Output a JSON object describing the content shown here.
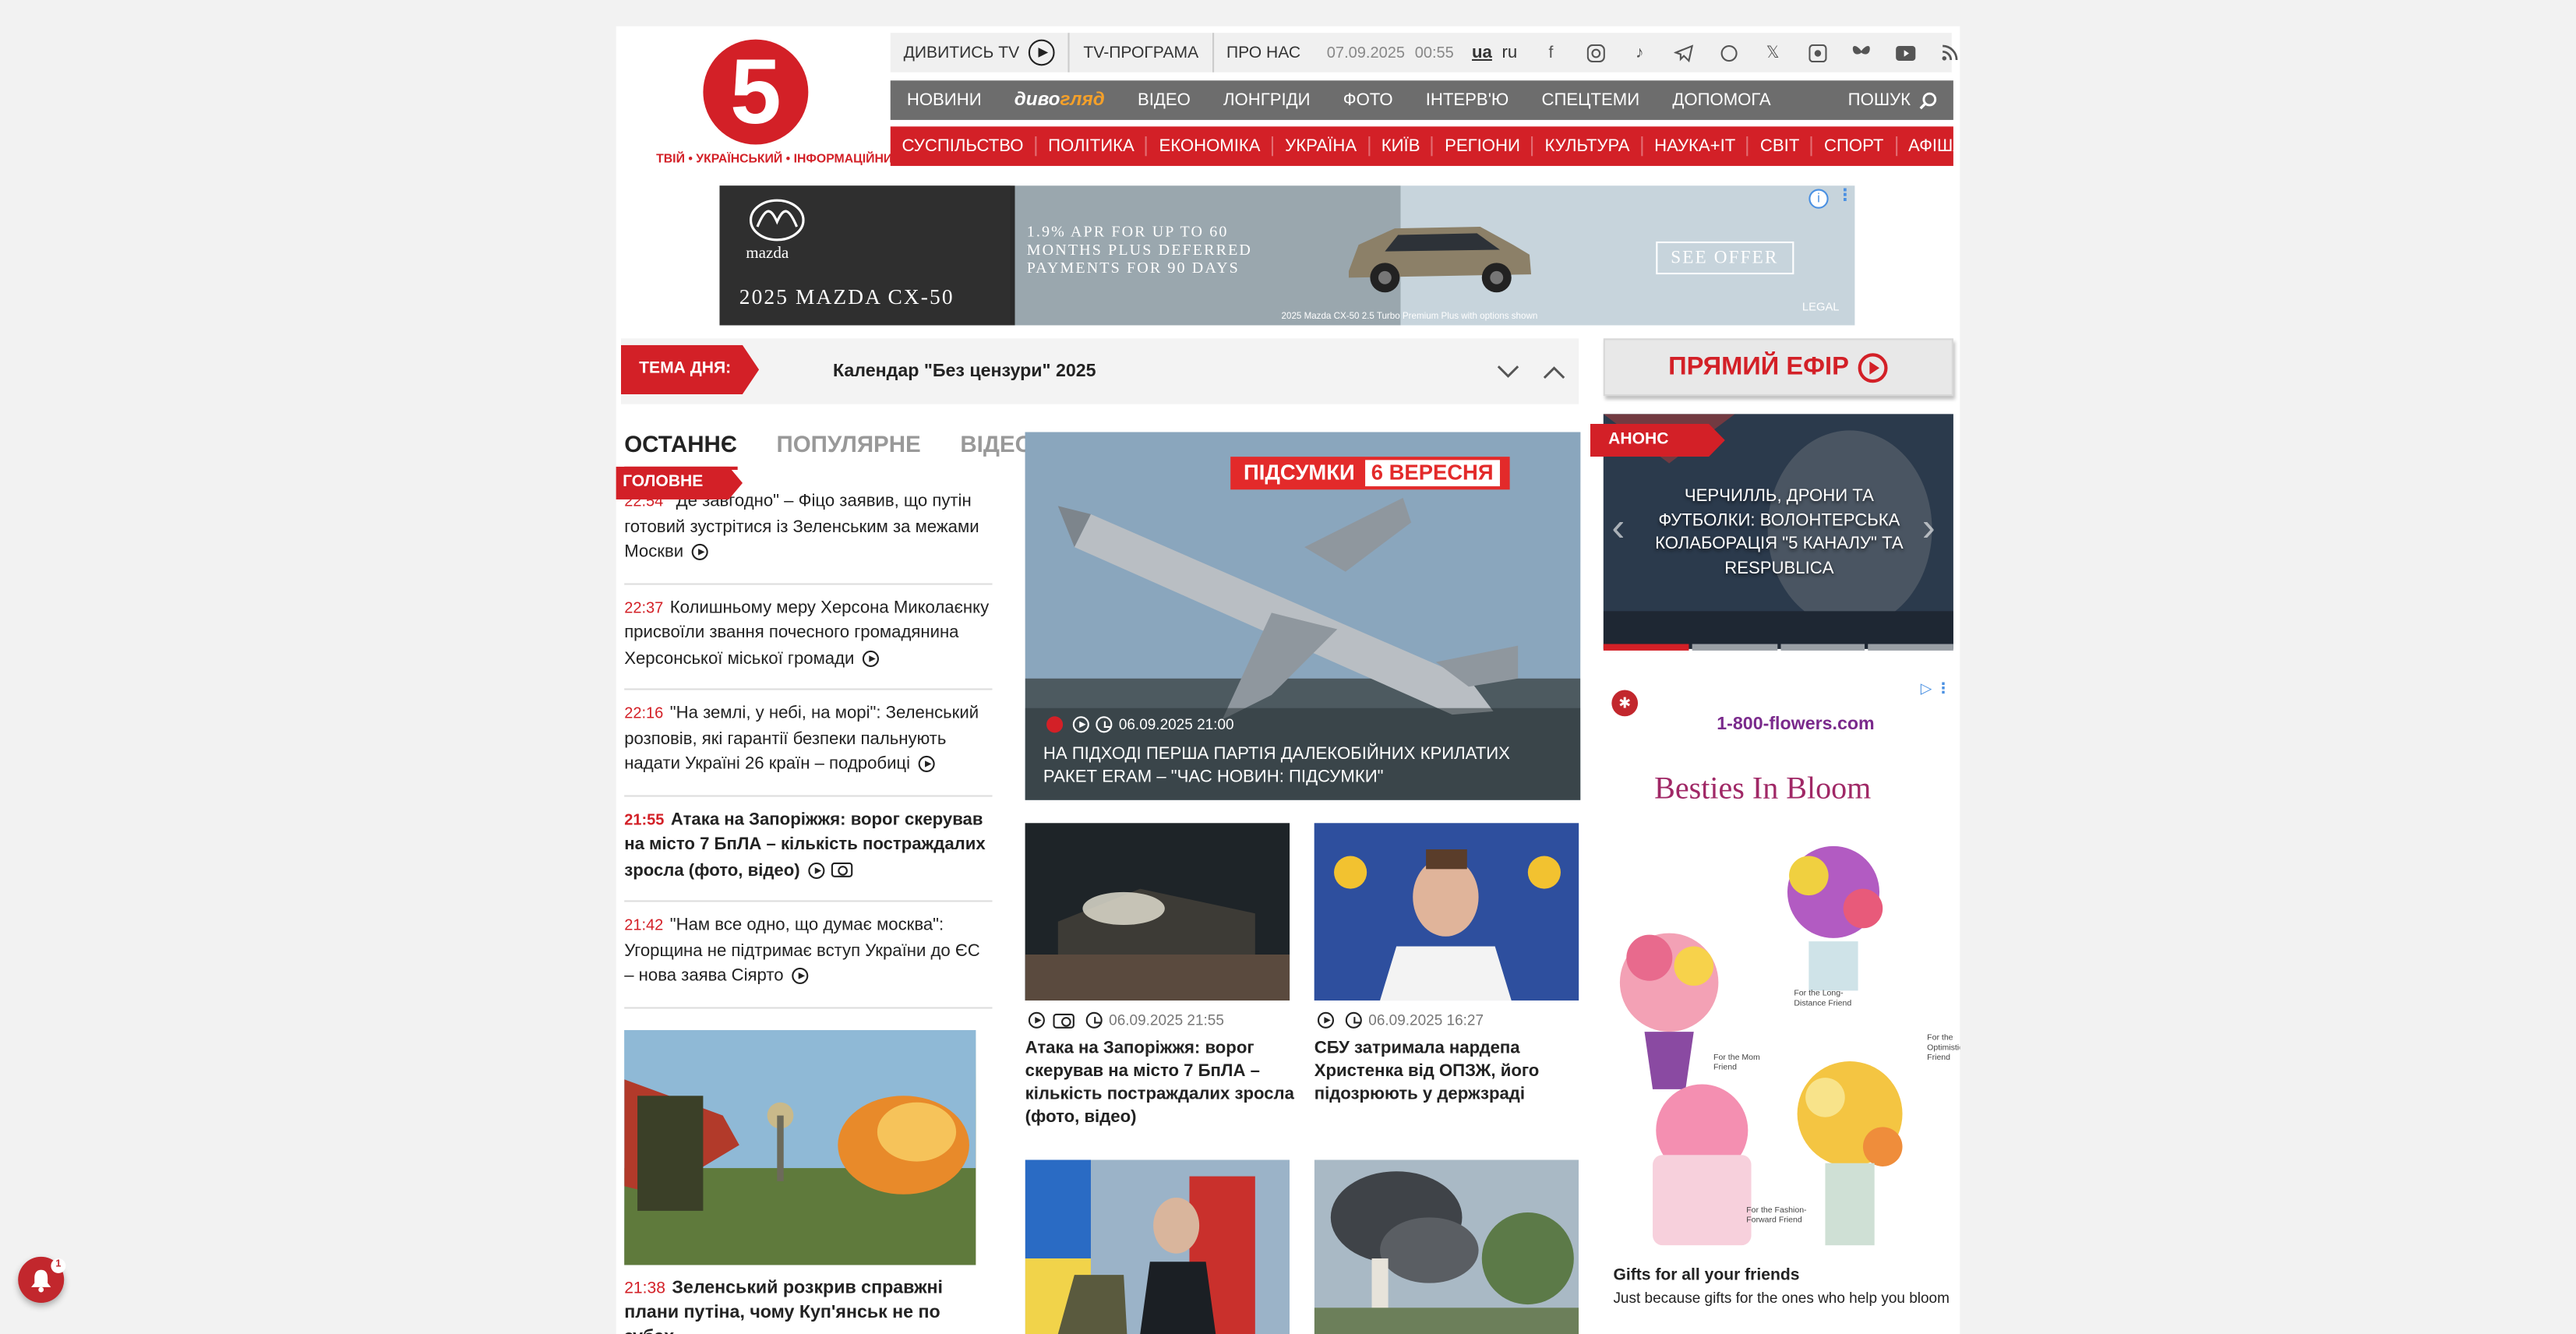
{
  "logo": {
    "number": "5",
    "tagline": "ТВІЙ • УКРАЇНСЬКИЙ • ІНФОРМАЦІЙНИЙ"
  },
  "topbar": {
    "watch_tv": "ДИВИТИСЬ TV",
    "tv_program": "TV-ПРОГРАМА",
    "about": "ПРО НАС",
    "date": "07.09.2025",
    "time": "00:55",
    "lang_ua": "ua",
    "lang_ru": "ru",
    "social": [
      "facebook-icon",
      "instagram-icon",
      "tiktok-icon",
      "telegram-icon",
      "whatsapp-icon",
      "x-icon",
      "threads-icon",
      "bluesky-icon",
      "youtube-icon",
      "rss-icon"
    ]
  },
  "nav_main": {
    "items": [
      "НОВИНИ",
      "ДИВОГЛЯД",
      "ВІДЕО",
      "ЛОНГРІДИ",
      "ФОТО",
      "ІНТЕРВ'Ю",
      "СПЕЦТЕМИ",
      "ДОПОМОГА"
    ],
    "divo_a": "диво",
    "divo_b": "гляд",
    "search": "ПОШУК"
  },
  "nav_sections": [
    "СУСПІЛЬСТВО",
    "ПОЛІТИКА",
    "ЕКОНОМІКА",
    "УКРАЇНА",
    "КИЇВ",
    "РЕГІОНИ",
    "КУЛЬТУРА",
    "НАУКА+IT",
    "СВІТ",
    "СПОРТ",
    "АФІША"
  ],
  "ad_top": {
    "brand": "mazda",
    "model": "2025 MAZDA CX-50",
    "copy": "1.9% APR FOR UP TO 60 MONTHS PLUS DEFERRED PAYMENTS FOR 90 DAYS",
    "cta": "SEE OFFER",
    "legal": "LEGAL",
    "fine": "2025 Mazda CX-50 2.5 Turbo Premium Plus with options shown"
  },
  "theme_day": {
    "tag": "ТЕМА ДНЯ:",
    "title": "Календар \"Без цензури\" 2025"
  },
  "live": {
    "label": "ПРЯМИЙ ЕФІР"
  },
  "tabs": [
    "ОСТАННЄ",
    "ПОПУЛЯРНЕ",
    "ВІДЕО"
  ],
  "news_list": [
    {
      "time": "22:54",
      "text": "\"Де завгодно\" – Фіцо заявив, що путін готовий зустрітися із Зеленським за межами Москви",
      "bold": false
    },
    {
      "time": "22:37",
      "text": "Колишньому меру Херсона Миколаєнку присвоїли звання почесного громадянина Херсонської міської громади",
      "bold": false
    },
    {
      "time": "22:16",
      "text": "\"На землі, у небі, на морі\": Зеленський розповів, які гарантії безпеки пальнують надати Україні 26 країн – подробиці",
      "bold": false
    },
    {
      "time": "21:55",
      "text": "Атака на Запоріжжя: ворог скерував на місто 7 БпЛА – кількість постраждалих зросла (фото, відео)",
      "bold": true
    },
    {
      "time": "21:42",
      "text": "\"Нам все одно, що думає москва\": Угорщина не підтримає вступ України до ЄС – нова заява Сіярто",
      "bold": false
    }
  ],
  "left_feature": {
    "time": "21:38",
    "title": "Зеленський розкрив справжні плани путіна, чому Куп'янськ не по зубах"
  },
  "hero": {
    "tag": "ГОЛОВНЕ",
    "badge": "ПІДСУМКИ",
    "badge_date": "6 ВЕРЕСНЯ",
    "datetime": "06.09.2025 21:00",
    "title": "НА ПІДХОДІ ПЕРША ПАРТІЯ ДАЛЕКОБІЙНИХ КРИЛАТИХ РАКЕТ ERAM – \"ЧАС НОВИН: ПІДСУМКИ\""
  },
  "cards": [
    {
      "datetime": "06.09.2025 21:55",
      "title": "Атака на Запоріжжя: ворог скерував на місто 7 БпЛА – кількість постраждалих зросла (фото, відео)"
    },
    {
      "datetime": "06.09.2025 16:27",
      "title": "СБУ затримала нардепа Христенка від ОПЗЖ, його підозрюють у держзраді"
    }
  ],
  "anons": {
    "tag": "АНОНС",
    "title": "ЧЕРЧИЛЛЬ, ДРОНИ ТА ФУТБОЛКИ: ВОЛОНТЕРСЬКА КОЛАБОРАЦІЯ \"5 КАНАЛУ\" ТА RESPUBLICA"
  },
  "ad_right": {
    "logo": "1-800-flowers.com",
    "headline": "Besties In Bloom",
    "notes": [
      "For the Long-Distance Friend",
      "For the Optimistic Friend",
      "For the Mom Friend",
      "For the Fashion-Forward Friend"
    ],
    "foot_title": "Gifts for all your friends",
    "foot_text": "Just because gifts for the ones who help you bloom"
  },
  "notifications": {
    "count": "1"
  }
}
